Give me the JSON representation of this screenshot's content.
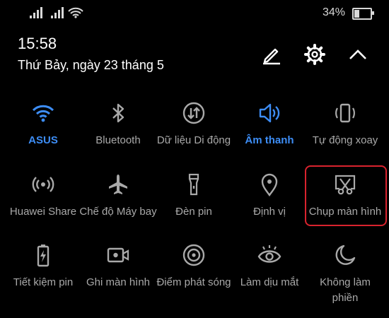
{
  "status_bar": {
    "battery_percent": "34%",
    "battery_level": 0.34
  },
  "header": {
    "time": "15:58",
    "date": "Thứ Bảy, ngày 23 tháng 5",
    "edit_icon": "pencil-icon",
    "settings_icon": "gear-icon",
    "collapse_icon": "chevron-up-icon"
  },
  "tiles": [
    {
      "label": "ASUS",
      "icon": "wifi-icon",
      "active": true
    },
    {
      "label": "Bluetooth",
      "icon": "bluetooth-icon",
      "active": false
    },
    {
      "label": "Dữ liệu Di động",
      "icon": "mobile-data-icon",
      "active": false
    },
    {
      "label": "Âm thanh",
      "icon": "sound-icon",
      "active": true
    },
    {
      "label": "Tự động xoay",
      "icon": "auto-rotate-icon",
      "active": false
    },
    {
      "label": "Huawei Share",
      "icon": "huawei-share-icon",
      "active": false
    },
    {
      "label": "Chế độ Máy bay",
      "icon": "airplane-icon",
      "active": false
    },
    {
      "label": "Đèn pin",
      "icon": "flashlight-icon",
      "active": false
    },
    {
      "label": "Định vị",
      "icon": "location-icon",
      "active": false
    },
    {
      "label": "Chụp màn hình",
      "icon": "screenshot-icon",
      "active": false,
      "highlighted": true
    },
    {
      "label": "Tiết kiệm pin",
      "icon": "battery-saver-icon",
      "active": false
    },
    {
      "label": "Ghi màn hình",
      "icon": "screen-record-icon",
      "active": false
    },
    {
      "label": "Điểm phát sóng",
      "icon": "hotspot-icon",
      "active": false
    },
    {
      "label": "Làm dịu mắt",
      "icon": "eye-comfort-icon",
      "active": false
    },
    {
      "label": "Không làm phiền",
      "icon": "do-not-disturb-icon",
      "active": false
    }
  ],
  "colors": {
    "active": "#3d8df5",
    "inactive": "#a9a9a9",
    "highlight": "#d9232e",
    "background": "#000000"
  }
}
